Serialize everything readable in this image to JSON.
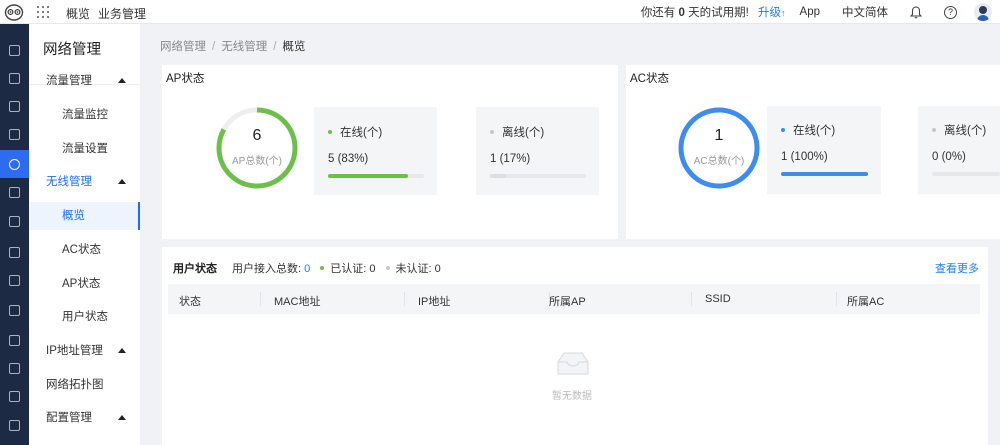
{
  "topbar": {
    "nav": [
      "概览",
      "业务管理"
    ],
    "trial_prefix": "你还有",
    "trial_days": "0",
    "trial_suffix": "天的试用期!",
    "upgrade": "升级",
    "upgrade_arrow": "↑",
    "app": "App",
    "language": "中文简体",
    "help": "?"
  },
  "rail": {
    "icons": [
      "dashboard-icon",
      "clock-icon",
      "bell-icon",
      "server-icon",
      "globe-icon",
      "list-icon",
      "calendar-icon",
      "box-icon",
      "yen-icon",
      "monitor-icon",
      "chart-icon",
      "network-icon",
      "cluster-icon",
      "gear-icon"
    ],
    "active_index": 4
  },
  "sidemenu": {
    "title": "网络管理",
    "items": [
      {
        "label": "流量管理",
        "type": "group",
        "expanded": true
      },
      {
        "label": "流量监控",
        "type": "sub"
      },
      {
        "label": "流量设置",
        "type": "sub"
      },
      {
        "label": "无线管理",
        "type": "group",
        "expanded": true,
        "highlight": true
      },
      {
        "label": "概览",
        "type": "sub",
        "active": true
      },
      {
        "label": "AC状态",
        "type": "sub"
      },
      {
        "label": "AP状态",
        "type": "sub"
      },
      {
        "label": "用户状态",
        "type": "sub"
      },
      {
        "label": "IP地址管理",
        "type": "group",
        "expanded": true
      },
      {
        "label": "网络拓扑图",
        "type": "group"
      },
      {
        "label": "配置管理",
        "type": "group",
        "expanded": true
      }
    ]
  },
  "breadcrumb": [
    "网络管理",
    "无线管理",
    "概览"
  ],
  "ap": {
    "title": "AP状态",
    "total": "6",
    "total_label": "AP总数(个)",
    "online_label": "在线(个)",
    "online_value": "5 (83%)",
    "online_ratio": 0.83,
    "offline_label": "离线(个)",
    "offline_value": "1 (17%)",
    "offline_ratio": 0.17
  },
  "ac": {
    "title": "AC状态",
    "total": "1",
    "total_label": "AC总数(个)",
    "online_label": "在线(个)",
    "online_value": "1 (100%)",
    "online_ratio": 1.0,
    "offline_label": "离线(个)",
    "offline_value": "0 (0%)",
    "offline_ratio": 0
  },
  "colors": {
    "green": "#6cc04a",
    "blue": "#3d8df0",
    "grey_dot": "#c8c8c8",
    "accent": "#1e7ff0"
  },
  "users": {
    "title": "用户状态",
    "total_label": "用户接入总数:",
    "total_value": "0",
    "auth_label": "已认证:",
    "auth_value": "0",
    "unauth_label": "未认证:",
    "unauth_value": "0",
    "see_more": "查看更多",
    "columns": [
      "状态",
      "MAC地址",
      "IP地址",
      "所属AP",
      "SSID",
      "所属AC"
    ],
    "empty_text": "暂无数据"
  }
}
